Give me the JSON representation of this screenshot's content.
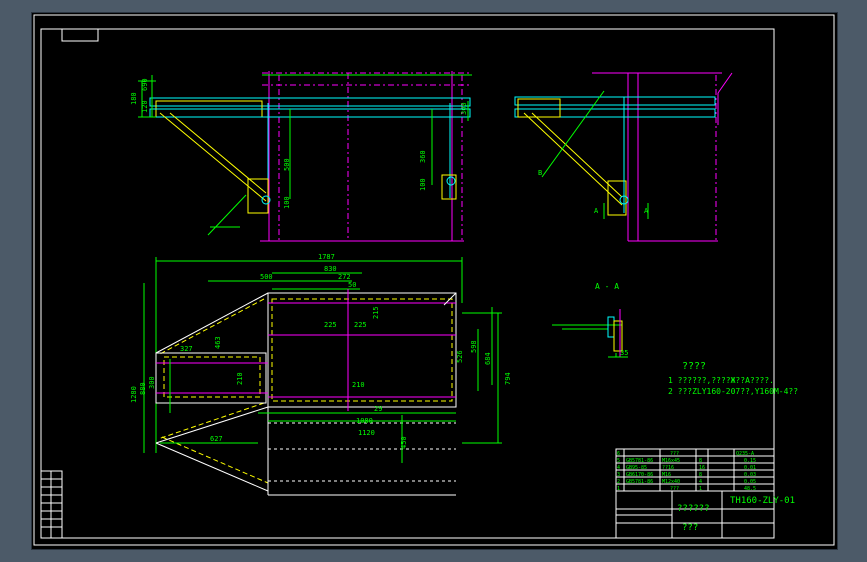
{
  "drawing": {
    "dims_top": [
      "1787",
      "830",
      "500",
      "272",
      "50"
    ],
    "dims_inner": [
      "225",
      "225",
      "215",
      "210",
      "29"
    ],
    "dims_bottom": [
      "1080",
      "1120",
      "450",
      "627"
    ],
    "dims_right": [
      "526",
      "598",
      "684",
      "794"
    ],
    "dims_left": [
      "1280",
      "880",
      "300",
      "463",
      "327",
      "210"
    ],
    "dims_elev": [
      "180",
      "120",
      "690",
      "300",
      "100",
      "360",
      "100",
      "500"
    ],
    "section_label": "A - A",
    "section_dim": "35",
    "tag_b": "B",
    "tag_a": "A"
  },
  "notes": {
    "heading": "????",
    "line1": "1 ??????,????Ж??A????.",
    "line2": "2 ???ZLY160-207??,Y160M-4??"
  },
  "title_block": {
    "drawing_no": "TH160-ZLY-01",
    "name": "??????",
    "company": "???"
  },
  "parts_list": {
    "rows": [
      [
        "6",
        "",
        "???",
        "",
        "Q235-A",
        "3.76"
      ],
      [
        "5",
        "GB5781-86",
        "M16x45",
        "8",
        "",
        "0.15"
      ],
      [
        "4",
        "GB95-85",
        "??16",
        "16",
        "",
        "0.01"
      ],
      [
        "3",
        "GB6170-86",
        "M16",
        "8",
        "",
        "0.03"
      ],
      [
        "2",
        "GB5781-86",
        "M12x40",
        "4",
        "",
        "0.05"
      ],
      [
        "1",
        "",
        "???",
        "1",
        "",
        "48.5"
      ]
    ]
  }
}
